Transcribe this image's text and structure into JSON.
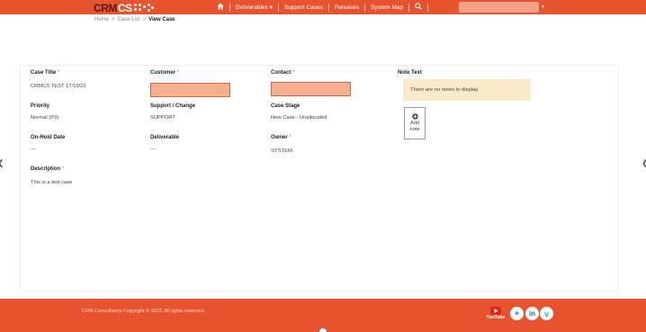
{
  "header": {
    "logo": {
      "crm": "CRM",
      "cs": "CS"
    },
    "nav": [
      {
        "label": "Deliverables",
        "has_dropdown": true
      },
      {
        "label": "Support Cases",
        "has_dropdown": false
      },
      {
        "label": "Releases",
        "has_dropdown": false
      },
      {
        "label": "System Map",
        "has_dropdown": false
      }
    ],
    "icons": {
      "home": "home-icon",
      "search": "search-icon",
      "user_menu": "caret-down-icon"
    },
    "accent_color": "#e8532f"
  },
  "breadcrumb": {
    "home": "Home",
    "list": "Case List",
    "current": "View Case",
    "separator": ">"
  },
  "case": {
    "title_label": "Case Title",
    "title_value": "CRMCS TEST 17/10/22",
    "customer_label": "Customer",
    "contact_label": "Contact",
    "note_text_label": "Note Text",
    "priority_label": "Priority",
    "priority_value": "Normal (P3)",
    "support_change_label": "Support / Change",
    "support_change_value": "SUPPORT",
    "case_stage_label": "Case Stage",
    "case_stage_value": "New Case - Unallocated",
    "onhold_label": "On-Hold Date",
    "onhold_value": "---",
    "deliverable_label": "Deliverable",
    "deliverable_value": "---",
    "owner_label": "Owner",
    "owner_value": "SYSTEM",
    "description_label": "Description",
    "description_value": "This is a test case",
    "required_marker": "*"
  },
  "notes": {
    "empty_message": "There are no notes to display.",
    "add_line1": "Add",
    "add_line2": "note",
    "add_icon": "plus-circle-icon"
  },
  "footer": {
    "copyright": "CRM Consultancy Copyright © 2022. All rights reserved.",
    "social": [
      "youtube-icon",
      "twitter-icon",
      "linkedin-icon",
      "vimeo-icon"
    ],
    "youtube_text": "YouTube"
  }
}
